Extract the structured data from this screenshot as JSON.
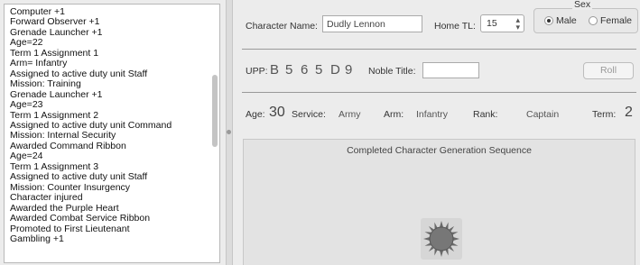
{
  "log": [
    "Computer +1",
    "Forward Observer +1",
    "Grenade Launcher +1",
    "Age=22",
    "Term 1 Assignment 1",
    "Arm= Infantry",
    "Assigned to active duty unit Staff",
    "Mission: Training",
    "Grenade Launcher +1",
    "Age=23",
    "Term 1 Assignment 2",
    "Assigned to active duty unit Command",
    "Mission: Internal Security",
    "Awarded Command Ribbon",
    "Age=24",
    "Term 1 Assignment 3",
    "Assigned to active duty unit Staff",
    "Mission: Counter Insurgency",
    "Character injured",
    "Awarded the Purple Heart",
    "Awarded Combat Service Ribbon",
    "Promoted to First Lieutenant",
    "Gambling +1"
  ],
  "character": {
    "name_label": "Character Name:",
    "name_value": "Dudly Lennon",
    "home_tl_label": "Home TL:",
    "home_tl_value": "15",
    "stepper_arrows": "▴▾"
  },
  "sex": {
    "title": "Sex",
    "male": "Male",
    "female": "Female",
    "selected": "Male"
  },
  "upp": {
    "label": "UPP:",
    "chars": [
      "B",
      "5",
      "6",
      "5",
      "D",
      "9"
    ],
    "noble_label": "Noble Title:",
    "noble_value": "",
    "roll_label": "Roll"
  },
  "stats": {
    "age_label": "Age:",
    "age_value": "30",
    "service_label": "Service:",
    "service_value": "Army",
    "arm_label": "Arm:",
    "arm_value": "Infantry",
    "rank_label": "Rank:",
    "rank_value": "Captain",
    "term_label": "Term:",
    "term_value": "2"
  },
  "sequence": {
    "title": "Completed Character Generation Sequence",
    "icon": "progress-spinner-icon"
  }
}
